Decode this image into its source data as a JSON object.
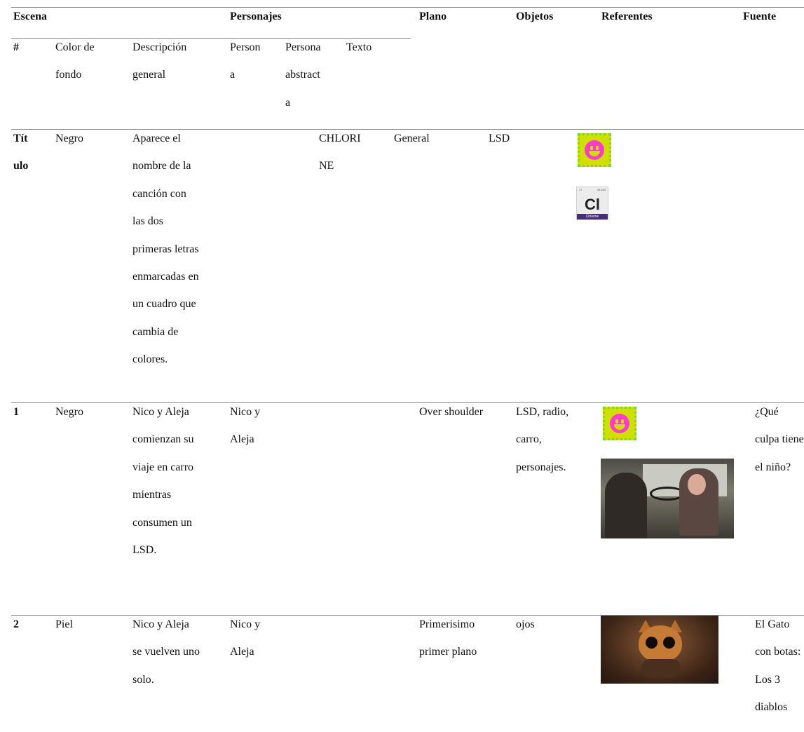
{
  "header": {
    "escena": "Escena",
    "personajes": "Personajes",
    "plano": "Plano",
    "objetos": "Objetos",
    "referentes": "Referentes",
    "fuente": "Fuente"
  },
  "subheader": {
    "num": "#",
    "color": [
      "Color de",
      "fondo"
    ],
    "descripcion": [
      "Descripción",
      "general"
    ],
    "persona": [
      "Person",
      "a"
    ],
    "persona_abstracta": [
      "Persona",
      "abstract",
      "a"
    ],
    "texto": "Texto"
  },
  "rows": [
    {
      "id": [
        "Tít",
        "ulo"
      ],
      "color": "Negro",
      "descripcion": [
        "Aparece el",
        "nombre de la",
        "canción con",
        "las dos",
        "primeras letras",
        "enmarcadas en",
        "un cuadro que",
        "cambia de",
        "colores."
      ],
      "texto": [
        "CHLORI",
        "NE"
      ],
      "plano": "General",
      "objetos": "LSD",
      "tile": {
        "symbol": "Cl",
        "name": "Chlorine",
        "number": "17",
        "mass": "35.453"
      }
    },
    {
      "id": "1",
      "color": "Negro",
      "descripcion": [
        "Nico y Aleja",
        "comienzan su",
        "viaje en carro",
        "mientras",
        "consumen un",
        "LSD."
      ],
      "persona": [
        "Nico y",
        "Aleja"
      ],
      "plano": "Over shoulder",
      "objetos": [
        "LSD, radio,",
        "carro,",
        "personajes."
      ],
      "fuente": [
        "¿Qué",
        "culpa tiene",
        "el niño?"
      ]
    },
    {
      "id": "2",
      "color": "Piel",
      "descripcion": [
        "Nico y Aleja",
        "se vuelven uno",
        "solo."
      ],
      "persona": [
        "Nico y",
        "Aleja"
      ],
      "plano": [
        "Primerisimo",
        "primer plano"
      ],
      "objetos": "ojos",
      "fuente": [
        "El Gato",
        "con botas:",
        "Los 3",
        "diablos"
      ]
    }
  ]
}
